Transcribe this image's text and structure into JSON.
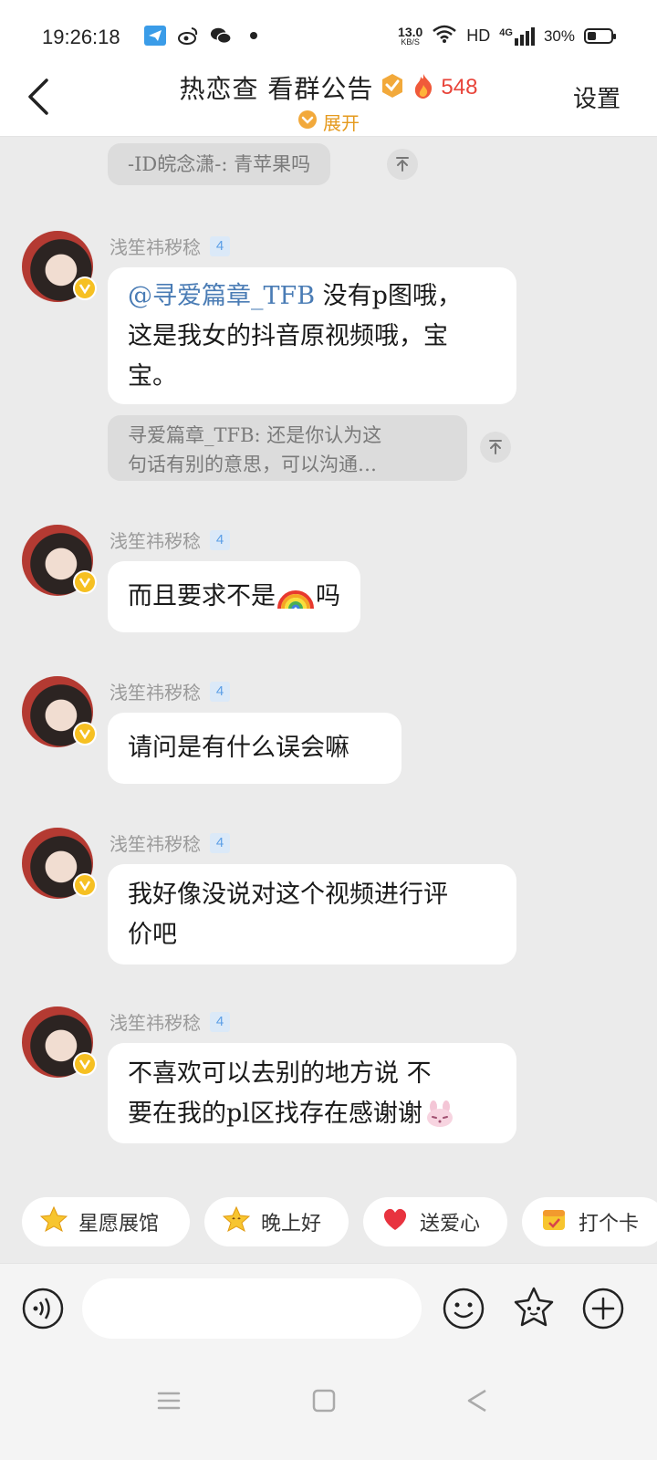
{
  "status_bar": {
    "time": "19:26:18",
    "net_speed_value": "13.0",
    "net_speed_unit": "KB/S",
    "hd": "HD",
    "network": "4G",
    "battery_pct": "30%"
  },
  "header": {
    "title": "热恋查 看群公告",
    "member_count": "548",
    "expand_label": "展开",
    "settings_label": "设置"
  },
  "chat": {
    "top_quote": "-ID皖念潇-: 青苹果吗",
    "messages": [
      {
        "sender": "浅笙祎秽稔",
        "level": "4",
        "mention": "@寻爱篇章_TFB",
        "text_line1_rest": " 没有p图哦，",
        "text_line2": "这是我女的抖音原视频哦，宝",
        "text_line3": "宝。",
        "quote_line1": "寻爱篇章_TFB: 还是你认为这",
        "quote_line2": "句话有别的意思，可以沟通…"
      },
      {
        "sender": "浅笙祎秽稔",
        "level": "4",
        "text_before": "而且要求不是",
        "text_after": "吗"
      },
      {
        "sender": "浅笙祎秽稔",
        "level": "4",
        "text": "请问是有什么误会嘛"
      },
      {
        "sender": "浅笙祎秽稔",
        "level": "4",
        "text_line1": "我好像没说对这个视频进行评",
        "text_line2": "价吧"
      },
      {
        "sender": "浅笙祎秽稔",
        "level": "4",
        "text_line1": "不喜欢可以去别的地方说  不",
        "text_line2": "要在我的pl区找存在感谢谢"
      }
    ]
  },
  "quick_chips": [
    {
      "label": "星愿展馆",
      "icon": "star-icon"
    },
    {
      "label": "晚上好",
      "icon": "star-face-icon"
    },
    {
      "label": "送爱心",
      "icon": "heart-icon"
    },
    {
      "label": "打个卡",
      "icon": "checkin-icon"
    }
  ],
  "input_bar": {
    "placeholder": ""
  },
  "colors": {
    "background": "#ebebeb",
    "mention": "#4a7cb5",
    "member_count": "#e8443a",
    "expand": "#e59a1e"
  }
}
